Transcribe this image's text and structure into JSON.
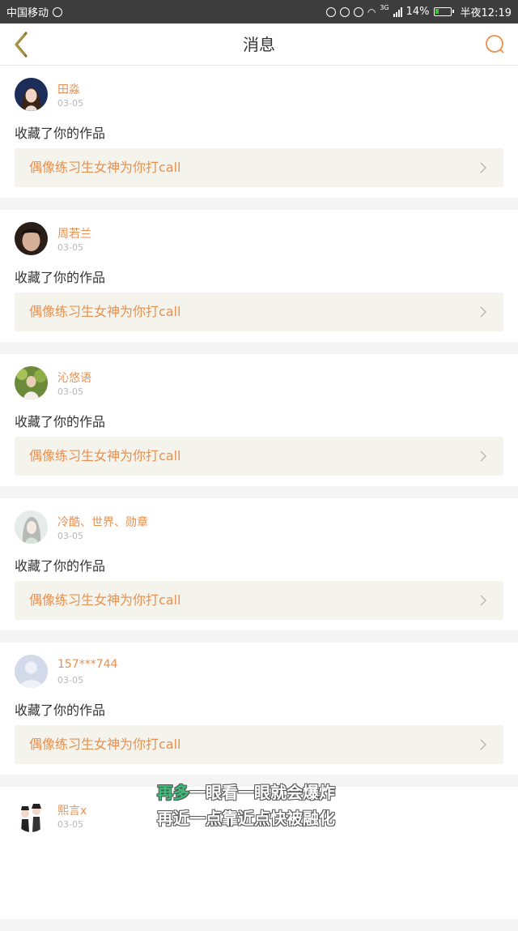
{
  "status_bar": {
    "carrier": "中国移动",
    "network": "3G",
    "battery": "14%",
    "time": "半夜12:19"
  },
  "nav": {
    "title": "消息",
    "back_icon": "chevron-left-icon",
    "search_icon": "search-icon",
    "accent_color": "#e8904f"
  },
  "messages": [
    {
      "username": "田淼",
      "date": "03-05",
      "action": "收藏了你的作品",
      "work_title": "偶像练习生女神为你打call",
      "avatar_color": "#1c2d5a"
    },
    {
      "username": "周若兰",
      "date": "03-05",
      "action": "收藏了你的作品",
      "work_title": "偶像练习生女神为你打call",
      "avatar_color": "#3a2a22"
    },
    {
      "username": "沁悠语",
      "date": "03-05",
      "action": "收藏了你的作品",
      "work_title": "偶像练习生女神为你打call",
      "avatar_color": "#6b8a3a"
    },
    {
      "username": "冷酷、世界、勋章",
      "date": "03-05",
      "action": "收藏了你的作品",
      "work_title": "偶像练习生女神为你打call",
      "avatar_color": "#cfd8d4"
    },
    {
      "username": "157***744",
      "date": "03-05",
      "action": "收藏了你的作品",
      "work_title": "偶像练习生女神为你打call",
      "avatar_color": "#c9d3e6"
    },
    {
      "username": "熙言x",
      "date": "03-05",
      "action": "",
      "work_title": "",
      "avatar_color": "#f2f2f2"
    }
  ],
  "overlay_subtitle": {
    "line1_accent": "再多",
    "line1_rest": "一眼看一眼就会爆炸",
    "line2": "再近一点靠近点快被融化"
  }
}
